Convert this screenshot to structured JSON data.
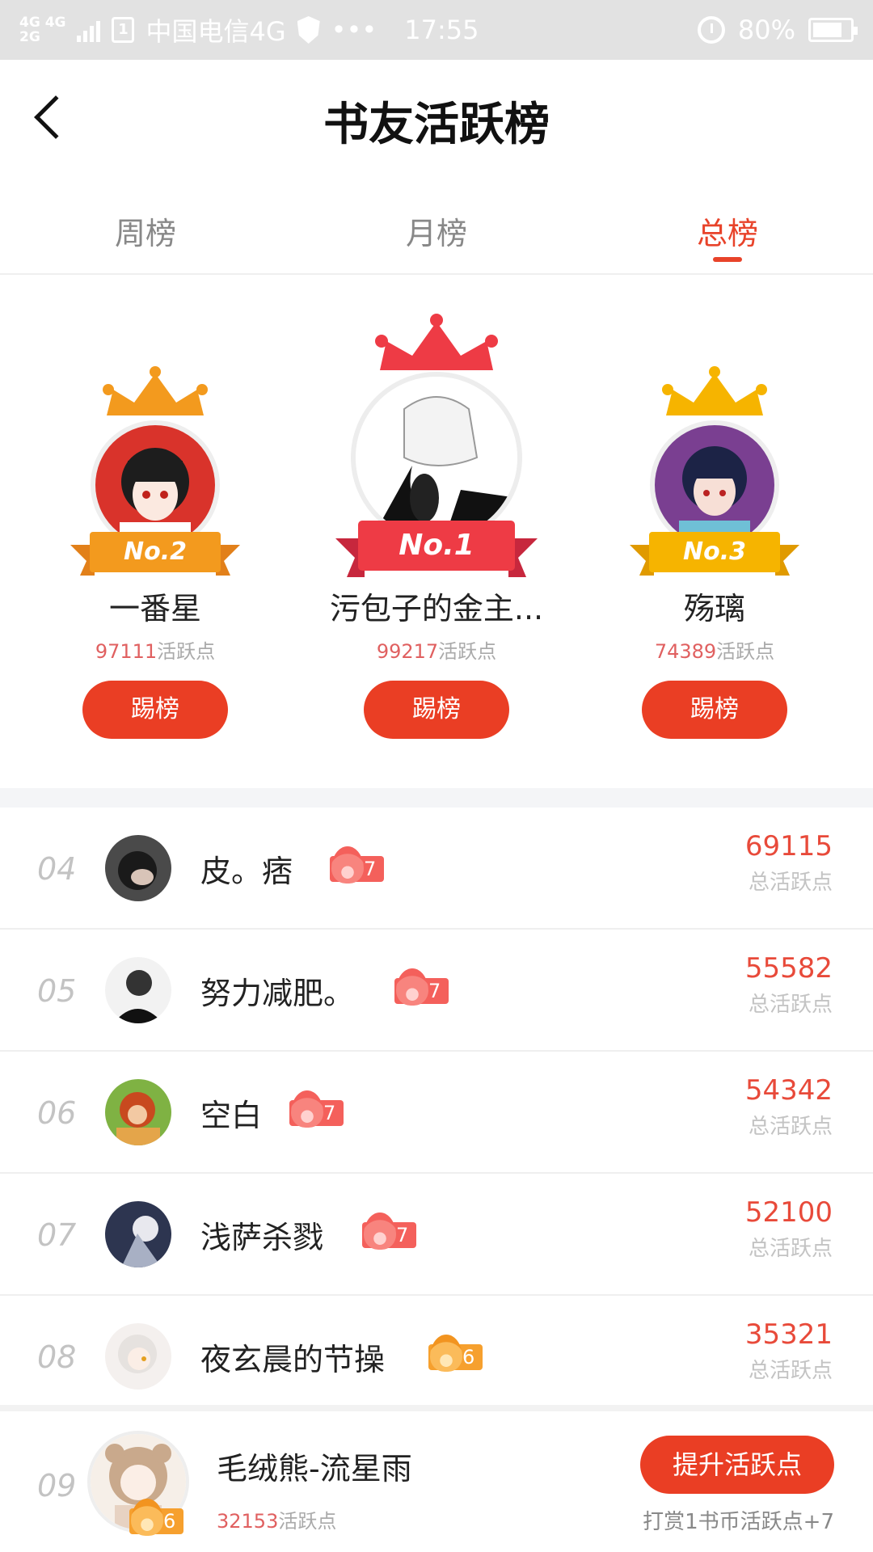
{
  "status_bar": {
    "network_top": "4G 4G",
    "network_bottom": "2G",
    "carrier": "中国电信4G",
    "more": "•••",
    "time": "17:55",
    "battery": "80%",
    "battery_level": 0.8
  },
  "header": {
    "title": "书友活跃榜"
  },
  "tabs": [
    {
      "label": "周榜",
      "active": false
    },
    {
      "label": "月榜",
      "active": false
    },
    {
      "label": "总榜",
      "active": true
    }
  ],
  "podium": {
    "points_label": "活跃点",
    "kick_label": "踢榜",
    "first": {
      "rank": "No.1",
      "name": "污包子的金主...",
      "points": "99217"
    },
    "second": {
      "rank": "No.2",
      "name": "一番星",
      "points": "97111"
    },
    "third": {
      "rank": "No.3",
      "name": "殇璃",
      "points": "74389"
    }
  },
  "list": {
    "score_label": "总活跃点",
    "rows": [
      {
        "rank": "04",
        "name": "皮。痞",
        "level": "7",
        "score": "69115"
      },
      {
        "rank": "05",
        "name": "努力减肥。",
        "level": "7",
        "score": "55582"
      },
      {
        "rank": "06",
        "name": "空白",
        "level": "7",
        "score": "54342"
      },
      {
        "rank": "07",
        "name": "浅萨杀戮",
        "level": "7",
        "score": "52100"
      },
      {
        "rank": "08",
        "name": "夜玄晨的节操",
        "level": "6",
        "score": "35321"
      }
    ]
  },
  "me": {
    "rank": "09",
    "name": "毛绒熊-流星雨",
    "points": "32153",
    "points_label": "活跃点",
    "level": "6",
    "boost_label": "提升活跃点",
    "hint": "打赏1书币活跃点+7"
  },
  "colors": {
    "accent": "#ea3e24",
    "gold": "#f6b400",
    "silver_orange": "#f39a1e"
  }
}
